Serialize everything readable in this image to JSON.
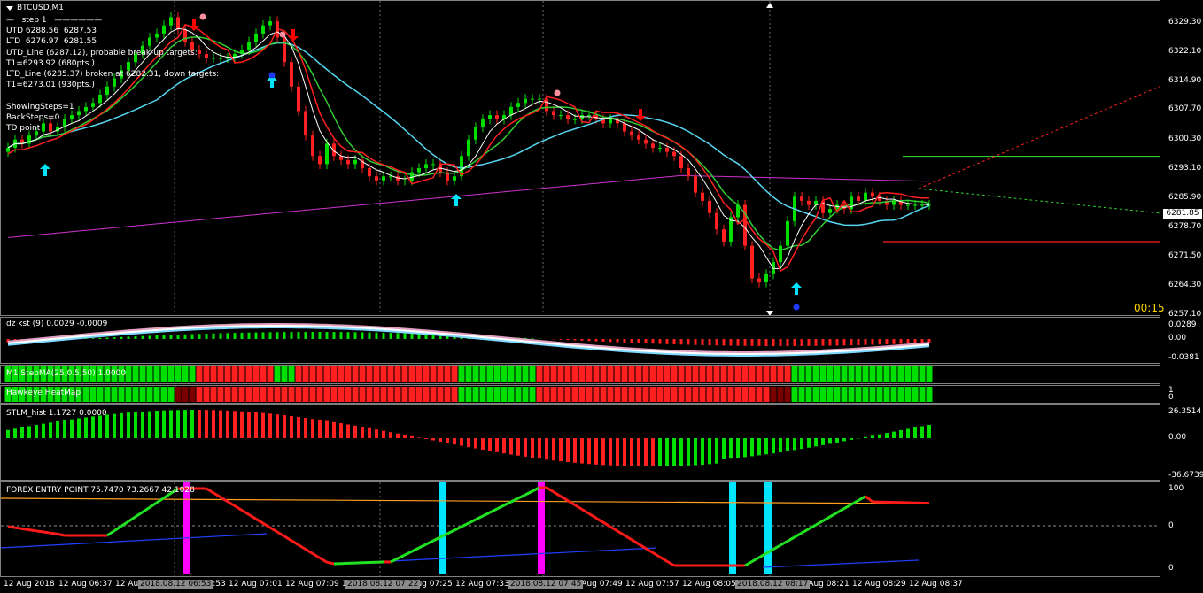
{
  "window": {
    "symbol_title": "BTCUSD,M1"
  },
  "main_info": [
    "—   step 1   ——————",
    "UTD 6288.56  6287.53",
    "LTD  6276.97  6281.55",
    "UTD_Line (6287.12), probable break-up targets:",
    "T1=6293.92 (680pts.)",
    "LTD_Line (6285.37) broken at 6282.31, down targets:",
    "T1=6273.01 (930pts.)",
    "",
    "ShowingSteps=1",
    "BackSteps=0",
    "TD point"
  ],
  "price_axis": [
    "6329.30",
    "6322.10",
    "6314.90",
    "6307.70",
    "6300.30",
    "6293.10",
    "6285.90",
    "6278.70",
    "6271.50",
    "6264.30",
    "6257.10"
  ],
  "current_price": "6281.85",
  "bar_timer": "00:15",
  "panes": {
    "kst": {
      "label": "dz kst (9) 0.0029 -0.0009",
      "axis": [
        "0.0289",
        "0.00",
        "-0.0381"
      ]
    },
    "stepma": {
      "label": "M1 StepMA(25,0.5,50) 1.0000"
    },
    "heatmap": {
      "label": "Hawkeye HeatMap",
      "axis": [
        "1",
        "0"
      ]
    },
    "stlm": {
      "label": "STLM_hist 1.1727 0.0000",
      "axis": [
        "26.3514",
        "0.00",
        "-36.6739"
      ]
    },
    "forex": {
      "label": "FOREX ENTRY POINT 75.7470 73.2667 42.1028",
      "axis": [
        "100",
        "0",
        "0"
      ]
    }
  },
  "time_axis": [
    "12 Aug 2018",
    "12 Aug 06:37",
    "12 Aug 06:45",
    "12 Aug 06:53",
    "12 Aug 07:01",
    "12 Aug 07:09",
    "12 Aug 07:17",
    "12 Aug 07:25",
    "12 Aug 07:33",
    "12 Aug 07:41",
    "12 Aug 07:49",
    "12 Aug 07:57",
    "12 Aug 08:05",
    "12 Aug 08:13",
    "12 Aug 08:21",
    "12 Aug 08:29",
    "12 Aug 08:37"
  ],
  "time_highlights": [
    "2018.08.12 06:53",
    "2018.08.12 07:22",
    "2018.08.12 07:45",
    "2018.08.12 08:17"
  ],
  "colors": {
    "bull": "#00e000",
    "bear": "#ff2020",
    "fast_ma": "#ffffff",
    "slow_ma": "#ff2020",
    "trend_ma": "#55d6f0",
    "long_ma": "#cc33cc",
    "signal_line": "#32cd32",
    "arrow_up": "#00e5ff",
    "arrow_down": "#ff0000",
    "entry_bar": "#ff00ff",
    "exit_bar": "#00e5ff"
  },
  "chart_data": {
    "type": "line",
    "symbol": "BTCUSD,M1",
    "ylim": [
      6255,
      6332
    ],
    "x": [
      "06:29",
      "06:30",
      "06:31",
      "06:32",
      "06:33",
      "06:34",
      "06:35",
      "06:36",
      "06:37",
      "06:38",
      "06:39",
      "06:40",
      "06:41",
      "06:42",
      "06:43",
      "06:44",
      "06:45",
      "06:46",
      "06:47",
      "06:48",
      "06:49",
      "06:50",
      "06:51",
      "06:52",
      "06:53",
      "06:54",
      "06:55",
      "06:56",
      "06:57",
      "06:58",
      "06:59",
      "07:00",
      "07:01",
      "07:02",
      "07:03",
      "07:04",
      "07:05",
      "07:06",
      "07:07",
      "07:08",
      "07:09",
      "07:10",
      "07:11",
      "07:12",
      "07:13",
      "07:14",
      "07:15",
      "07:16",
      "07:17",
      "07:18",
      "07:19",
      "07:20",
      "07:21",
      "07:22",
      "07:23",
      "07:24",
      "07:25",
      "07:26",
      "07:27",
      "07:28",
      "07:29",
      "07:30",
      "07:31",
      "07:32",
      "07:33",
      "07:34",
      "07:35",
      "07:36",
      "07:37",
      "07:38",
      "07:39",
      "07:40",
      "07:41",
      "07:42",
      "07:43",
      "07:44",
      "07:45",
      "07:46",
      "07:47",
      "07:48",
      "07:49",
      "07:50",
      "07:51",
      "07:52",
      "07:53",
      "07:54",
      "07:55",
      "07:56",
      "07:57",
      "07:58",
      "07:59",
      "08:00",
      "08:01",
      "08:02",
      "08:03",
      "08:04",
      "08:05",
      "08:06",
      "08:07",
      "08:08",
      "08:09",
      "08:10",
      "08:11",
      "08:12",
      "08:13",
      "08:14",
      "08:15",
      "08:16",
      "08:17",
      "08:18",
      "08:19",
      "08:20",
      "08:21",
      "08:22",
      "08:23",
      "08:24",
      "08:25",
      "08:26",
      "08:27",
      "08:28",
      "08:29",
      "08:30",
      "08:31",
      "08:32",
      "08:33",
      "08:34",
      "08:35",
      "08:36",
      "08:37",
      "08:38",
      "08:39"
    ],
    "close": [
      6296,
      6298,
      6297,
      6299,
      6300,
      6302,
      6300,
      6301,
      6303,
      6304,
      6305,
      6306,
      6307,
      6309,
      6311,
      6313,
      6315,
      6317,
      6319,
      6321,
      6323,
      6324,
      6326,
      6328,
      6325,
      6322,
      6320,
      6319,
      6318,
      6318,
      6318,
      6318,
      6319,
      6320,
      6322,
      6324,
      6326,
      6327,
      6323,
      6317,
      6311,
      6305,
      6299,
      6294,
      6292,
      6297,
      6294,
      6293,
      6292,
      6293,
      6291,
      6289,
      6288,
      6289,
      6289,
      6288,
      6288,
      6290,
      6291,
      6292,
      6292,
      6290,
      6288,
      6289,
      6294,
      6298,
      6301,
      6303,
      6304,
      6303,
      6304,
      6306,
      6307,
      6308,
      6308,
      6308,
      6305,
      6304,
      6304,
      6303,
      6303,
      6304,
      6304,
      6303,
      6302,
      6303,
      6302,
      6300,
      6299,
      6298,
      6297,
      6296,
      6296,
      6295,
      6294,
      6291,
      6289,
      6285,
      6283,
      6280,
      6276,
      6273,
      6279,
      6282,
      6272,
      6264,
      6263,
      6265,
      6268,
      6272,
      6278,
      6284,
      6283,
      6282,
      6283,
      6280,
      6281,
      6282,
      6281,
      6284,
      6283,
      6285,
      6284,
      6283,
      6282,
      6283,
      6282,
      6282,
      6282,
      6282,
      6282
    ],
    "series": [
      {
        "name": "UTD_Line (6287.12)",
        "values": [
          6287.12
        ]
      },
      {
        "name": "LTD_Line (6285.37)",
        "values": [
          6285.37
        ]
      }
    ]
  }
}
